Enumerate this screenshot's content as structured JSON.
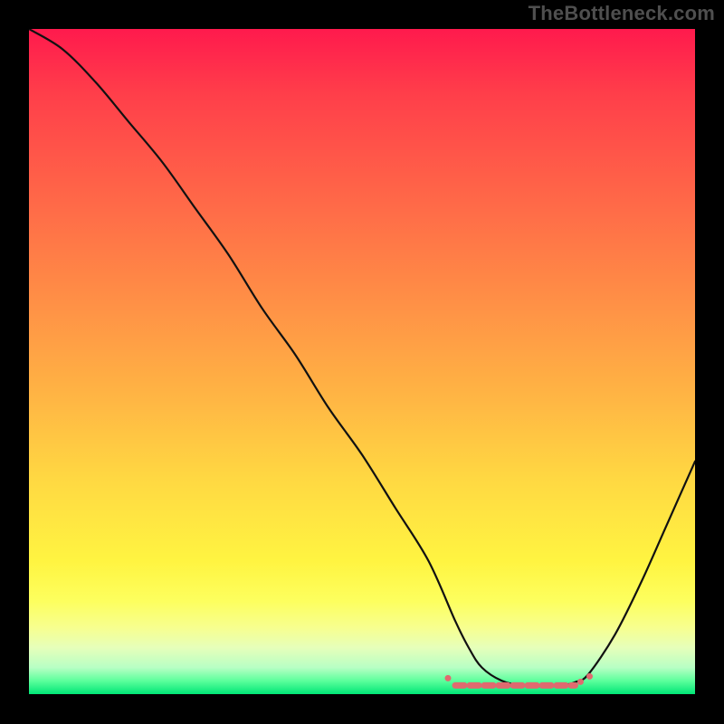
{
  "watermark": "TheBottleneck.com",
  "colors": {
    "background": "#000000",
    "watermark": "#4f4f4f",
    "curve": "#111111",
    "flat_marker": "#e06a6f"
  },
  "chart_data": {
    "type": "line",
    "title": "",
    "xlabel": "",
    "ylabel": "",
    "xlim": [
      0,
      100
    ],
    "ylim": [
      0,
      100
    ],
    "series": [
      {
        "name": "bottleneck-curve",
        "x": [
          0,
          5,
          10,
          15,
          20,
          25,
          30,
          35,
          40,
          45,
          50,
          55,
          60,
          64,
          66,
          68,
          71,
          74,
          77,
          80,
          82,
          84,
          88,
          92,
          96,
          100
        ],
        "y": [
          100,
          97,
          92,
          86,
          80,
          73,
          66,
          58,
          51,
          43,
          36,
          28,
          20,
          11,
          7,
          4,
          2,
          1.3,
          1.2,
          1.3,
          1.8,
          3,
          9,
          17,
          26,
          35
        ]
      }
    ],
    "optimal_zone": {
      "x_start": 64,
      "x_end": 82,
      "y": 1.3
    },
    "gradient_stops": [
      {
        "pos": 0.0,
        "color": "#ff1a4d"
      },
      {
        "pos": 0.1,
        "color": "#ff3f4a"
      },
      {
        "pos": 0.25,
        "color": "#ff6648"
      },
      {
        "pos": 0.4,
        "color": "#ff8d46"
      },
      {
        "pos": 0.55,
        "color": "#ffb444"
      },
      {
        "pos": 0.68,
        "color": "#ffd942"
      },
      {
        "pos": 0.8,
        "color": "#fff441"
      },
      {
        "pos": 0.86,
        "color": "#fdff5e"
      },
      {
        "pos": 0.9,
        "color": "#f7ff8f"
      },
      {
        "pos": 0.93,
        "color": "#e6ffba"
      },
      {
        "pos": 0.96,
        "color": "#b8ffc4"
      },
      {
        "pos": 0.98,
        "color": "#5cff9c"
      },
      {
        "pos": 1.0,
        "color": "#00e676"
      }
    ]
  }
}
